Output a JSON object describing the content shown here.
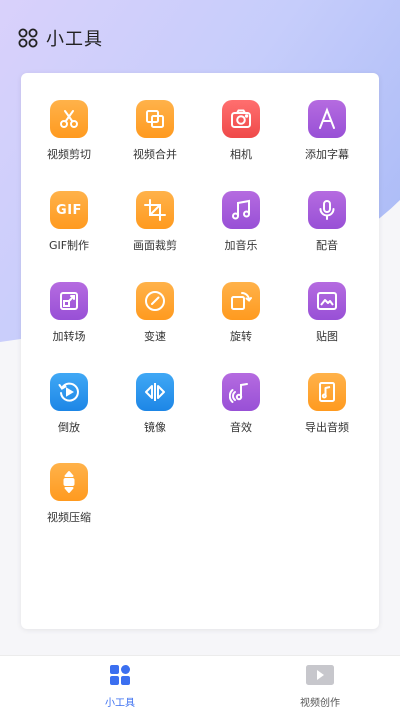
{
  "header": {
    "title": "小工具",
    "icon": "grid-apps-icon"
  },
  "colors": {
    "accent": "#3b6ff0",
    "tab_inactive": "#555555",
    "orange": "#ff9a1f",
    "purple": "#9d55d9",
    "blue": "#1d86e6",
    "red": "#f05050"
  },
  "tools": [
    {
      "label": "视频剪切",
      "icon": "scissors-icon",
      "color": "orange"
    },
    {
      "label": "视频合并",
      "icon": "merge-icon",
      "color": "orange"
    },
    {
      "label": "相机",
      "icon": "camera-icon",
      "color": "red"
    },
    {
      "label": "添加字幕",
      "icon": "subtitle-icon",
      "color": "purple"
    },
    {
      "label": "GIF制作",
      "icon": "gif-icon",
      "icon_text": "GIF",
      "color": "orange"
    },
    {
      "label": "画面裁剪",
      "icon": "crop-icon",
      "color": "orange"
    },
    {
      "label": "加音乐",
      "icon": "music-note-icon",
      "color": "purple"
    },
    {
      "label": "配音",
      "icon": "microphone-icon",
      "color": "purple"
    },
    {
      "label": "加转场",
      "icon": "transition-icon",
      "color": "purple"
    },
    {
      "label": "变速",
      "icon": "speed-icon",
      "color": "orange"
    },
    {
      "label": "旋转",
      "icon": "rotate-icon",
      "color": "orange"
    },
    {
      "label": "贴图",
      "icon": "sticker-image-icon",
      "color": "purple"
    },
    {
      "label": "倒放",
      "icon": "reverse-play-icon",
      "color": "blue"
    },
    {
      "label": "镜像",
      "icon": "mirror-icon",
      "color": "blue"
    },
    {
      "label": "音效",
      "icon": "sound-effect-icon",
      "color": "purple"
    },
    {
      "label": "导出音频",
      "icon": "export-audio-icon",
      "color": "orange"
    },
    {
      "label": "视频压缩",
      "icon": "compress-icon",
      "color": "orange"
    }
  ],
  "tabbar": {
    "tools_label": "小工具",
    "tools_icon": "tools-grid-icon",
    "create_label": "视频创作",
    "create_icon": "video-play-icon",
    "active": "tools"
  }
}
